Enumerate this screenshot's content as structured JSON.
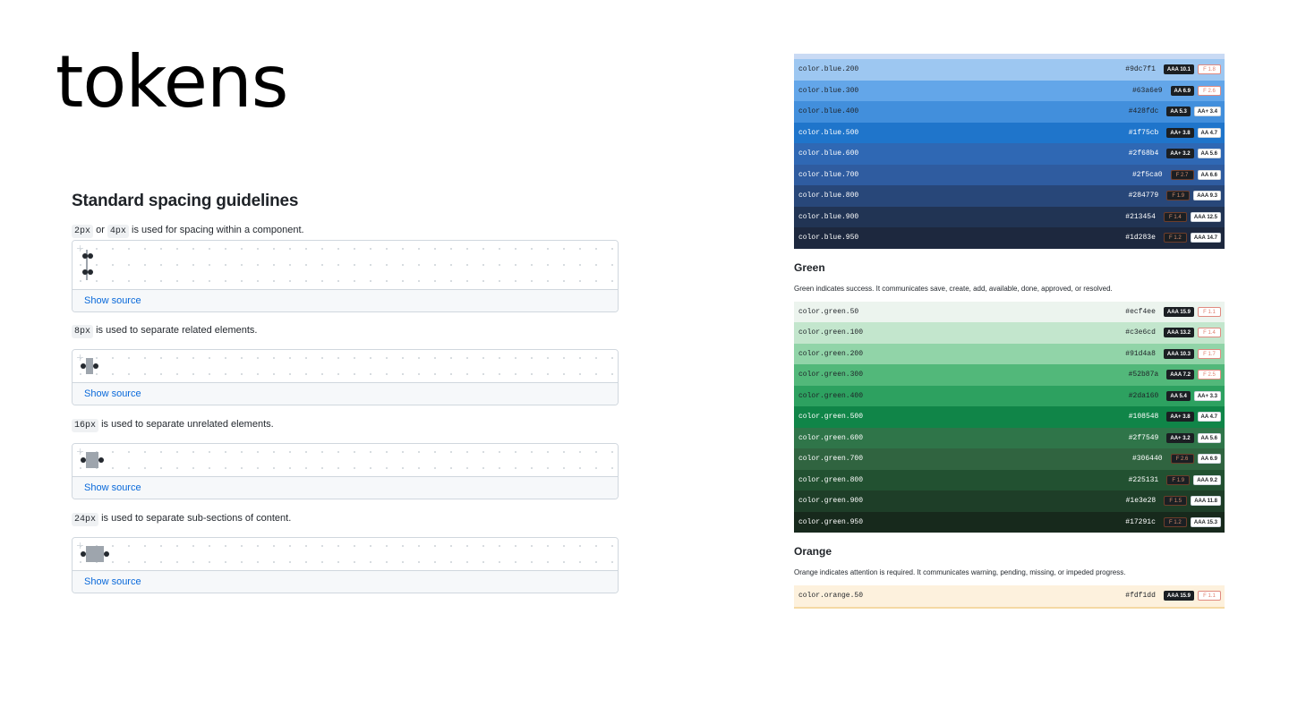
{
  "slide_title": "tokens",
  "spacing": {
    "heading": "Standard spacing guidelines",
    "source_label": "Show source",
    "items": [
      {
        "codes": [
          "2px",
          "4px"
        ],
        "joiner": "or",
        "text": "is used for spacing within a component."
      },
      {
        "codes": [
          "8px"
        ],
        "joiner": "",
        "text": "is used to separate related elements."
      },
      {
        "codes": [
          "16px"
        ],
        "joiner": "",
        "text": "is used to separate unrelated elements."
      },
      {
        "codes": [
          "24px"
        ],
        "joiner": "",
        "text": "is used to separate sub-sections of content."
      }
    ]
  },
  "colors": {
    "blue": [
      {
        "name": "color.blue.200",
        "hex": "#9dc7f1",
        "bg": "#9dc7f1",
        "fg": "#1f2328",
        "dark": "AAA 10.1",
        "light": "F 1.8",
        "dark_fail": false,
        "light_fail": true
      },
      {
        "name": "color.blue.300",
        "hex": "#63a6e9",
        "bg": "#63a6e9",
        "fg": "#1f2328",
        "dark": "AA 6.9",
        "light": "F 2.6",
        "dark_fail": false,
        "light_fail": true
      },
      {
        "name": "color.blue.400",
        "hex": "#428fdc",
        "bg": "#428fdc",
        "fg": "#1f2328",
        "dark": "AA 5.3",
        "light": "AA+ 3.4",
        "dark_fail": false,
        "light_fail": false
      },
      {
        "name": "color.blue.500",
        "hex": "#1f75cb",
        "bg": "#1f75cb",
        "fg": "#ffffff",
        "dark": "AA+ 3.8",
        "light": "AA 4.7",
        "dark_fail": false,
        "light_fail": false
      },
      {
        "name": "color.blue.600",
        "hex": "#2f68b4",
        "bg": "#2f68b4",
        "fg": "#ffffff",
        "dark": "AA+ 3.2",
        "light": "AA 5.6",
        "dark_fail": false,
        "light_fail": false
      },
      {
        "name": "color.blue.700",
        "hex": "#2f5ca0",
        "bg": "#2f5ca0",
        "fg": "#ffffff",
        "dark": "F 2.7",
        "light": "AA 6.6",
        "dark_fail": true,
        "light_fail": false
      },
      {
        "name": "color.blue.800",
        "hex": "#284779",
        "bg": "#284779",
        "fg": "#ffffff",
        "dark": "F 1.9",
        "light": "AAA 9.3",
        "dark_fail": true,
        "light_fail": false
      },
      {
        "name": "color.blue.900",
        "hex": "#213454",
        "bg": "#213454",
        "fg": "#ffffff",
        "dark": "F 1.4",
        "light": "AAA 12.5",
        "dark_fail": true,
        "light_fail": false
      },
      {
        "name": "color.blue.950",
        "hex": "#1d283e",
        "bg": "#1d283e",
        "fg": "#ffffff",
        "dark": "F 1.2",
        "light": "AAA 14.7",
        "dark_fail": true,
        "light_fail": false
      }
    ],
    "green": {
      "heading": "Green",
      "description": "Green indicates success. It communicates save, create, add, available, done, approved, or resolved.",
      "rows": [
        {
          "name": "color.green.50",
          "hex": "#ecf4ee",
          "bg": "#ecf4ee",
          "fg": "#1f2328",
          "dark": "AAA 15.9",
          "light": "F 1.1",
          "dark_fail": false,
          "light_fail": true
        },
        {
          "name": "color.green.100",
          "hex": "#c3e6cd",
          "bg": "#c3e6cd",
          "fg": "#1f2328",
          "dark": "AAA 13.2",
          "light": "F 1.4",
          "dark_fail": false,
          "light_fail": true
        },
        {
          "name": "color.green.200",
          "hex": "#91d4a8",
          "bg": "#91d4a8",
          "fg": "#1f2328",
          "dark": "AAA 10.3",
          "light": "F 1.7",
          "dark_fail": false,
          "light_fail": true
        },
        {
          "name": "color.green.300",
          "hex": "#52b87a",
          "bg": "#52b87a",
          "fg": "#1f2328",
          "dark": "AAA 7.2",
          "light": "F 2.5",
          "dark_fail": false,
          "light_fail": true
        },
        {
          "name": "color.green.400",
          "hex": "#2da160",
          "bg": "#2da160",
          "fg": "#1f2328",
          "dark": "AA 5.4",
          "light": "AA+ 3.3",
          "dark_fail": false,
          "light_fail": false
        },
        {
          "name": "color.green.500",
          "hex": "#108548",
          "bg": "#108548",
          "fg": "#ffffff",
          "dark": "AA+ 3.8",
          "light": "AA 4.7",
          "dark_fail": false,
          "light_fail": false
        },
        {
          "name": "color.green.600",
          "hex": "#2f7549",
          "bg": "#2f7549",
          "fg": "#ffffff",
          "dark": "AA+ 3.2",
          "light": "AA 5.6",
          "dark_fail": false,
          "light_fail": false
        },
        {
          "name": "color.green.700",
          "hex": "#306440",
          "bg": "#306440",
          "fg": "#ffffff",
          "dark": "F 2.6",
          "light": "AA 6.9",
          "dark_fail": true,
          "light_fail": false
        },
        {
          "name": "color.green.800",
          "hex": "#225131",
          "bg": "#225131",
          "fg": "#ffffff",
          "dark": "F 1.9",
          "light": "AAA 9.2",
          "dark_fail": true,
          "light_fail": false
        },
        {
          "name": "color.green.900",
          "hex": "#1e3e28",
          "bg": "#1e3e28",
          "fg": "#ffffff",
          "dark": "F 1.5",
          "light": "AAA 11.8",
          "dark_fail": true,
          "light_fail": false
        },
        {
          "name": "color.green.950",
          "hex": "#17291c",
          "bg": "#17291c",
          "fg": "#ffffff",
          "dark": "F 1.2",
          "light": "AAA 15.3",
          "dark_fail": true,
          "light_fail": false
        }
      ]
    },
    "orange": {
      "heading": "Orange",
      "description": "Orange indicates attention is required. It communicates warning, pending, missing, or impeded progress.",
      "rows": [
        {
          "name": "color.orange.50",
          "hex": "#fdf1dd",
          "bg": "#fdf1dd",
          "fg": "#1f2328",
          "dark": "AAA 15.9",
          "light": "F 1.1",
          "dark_fail": false,
          "light_fail": true
        }
      ]
    }
  }
}
